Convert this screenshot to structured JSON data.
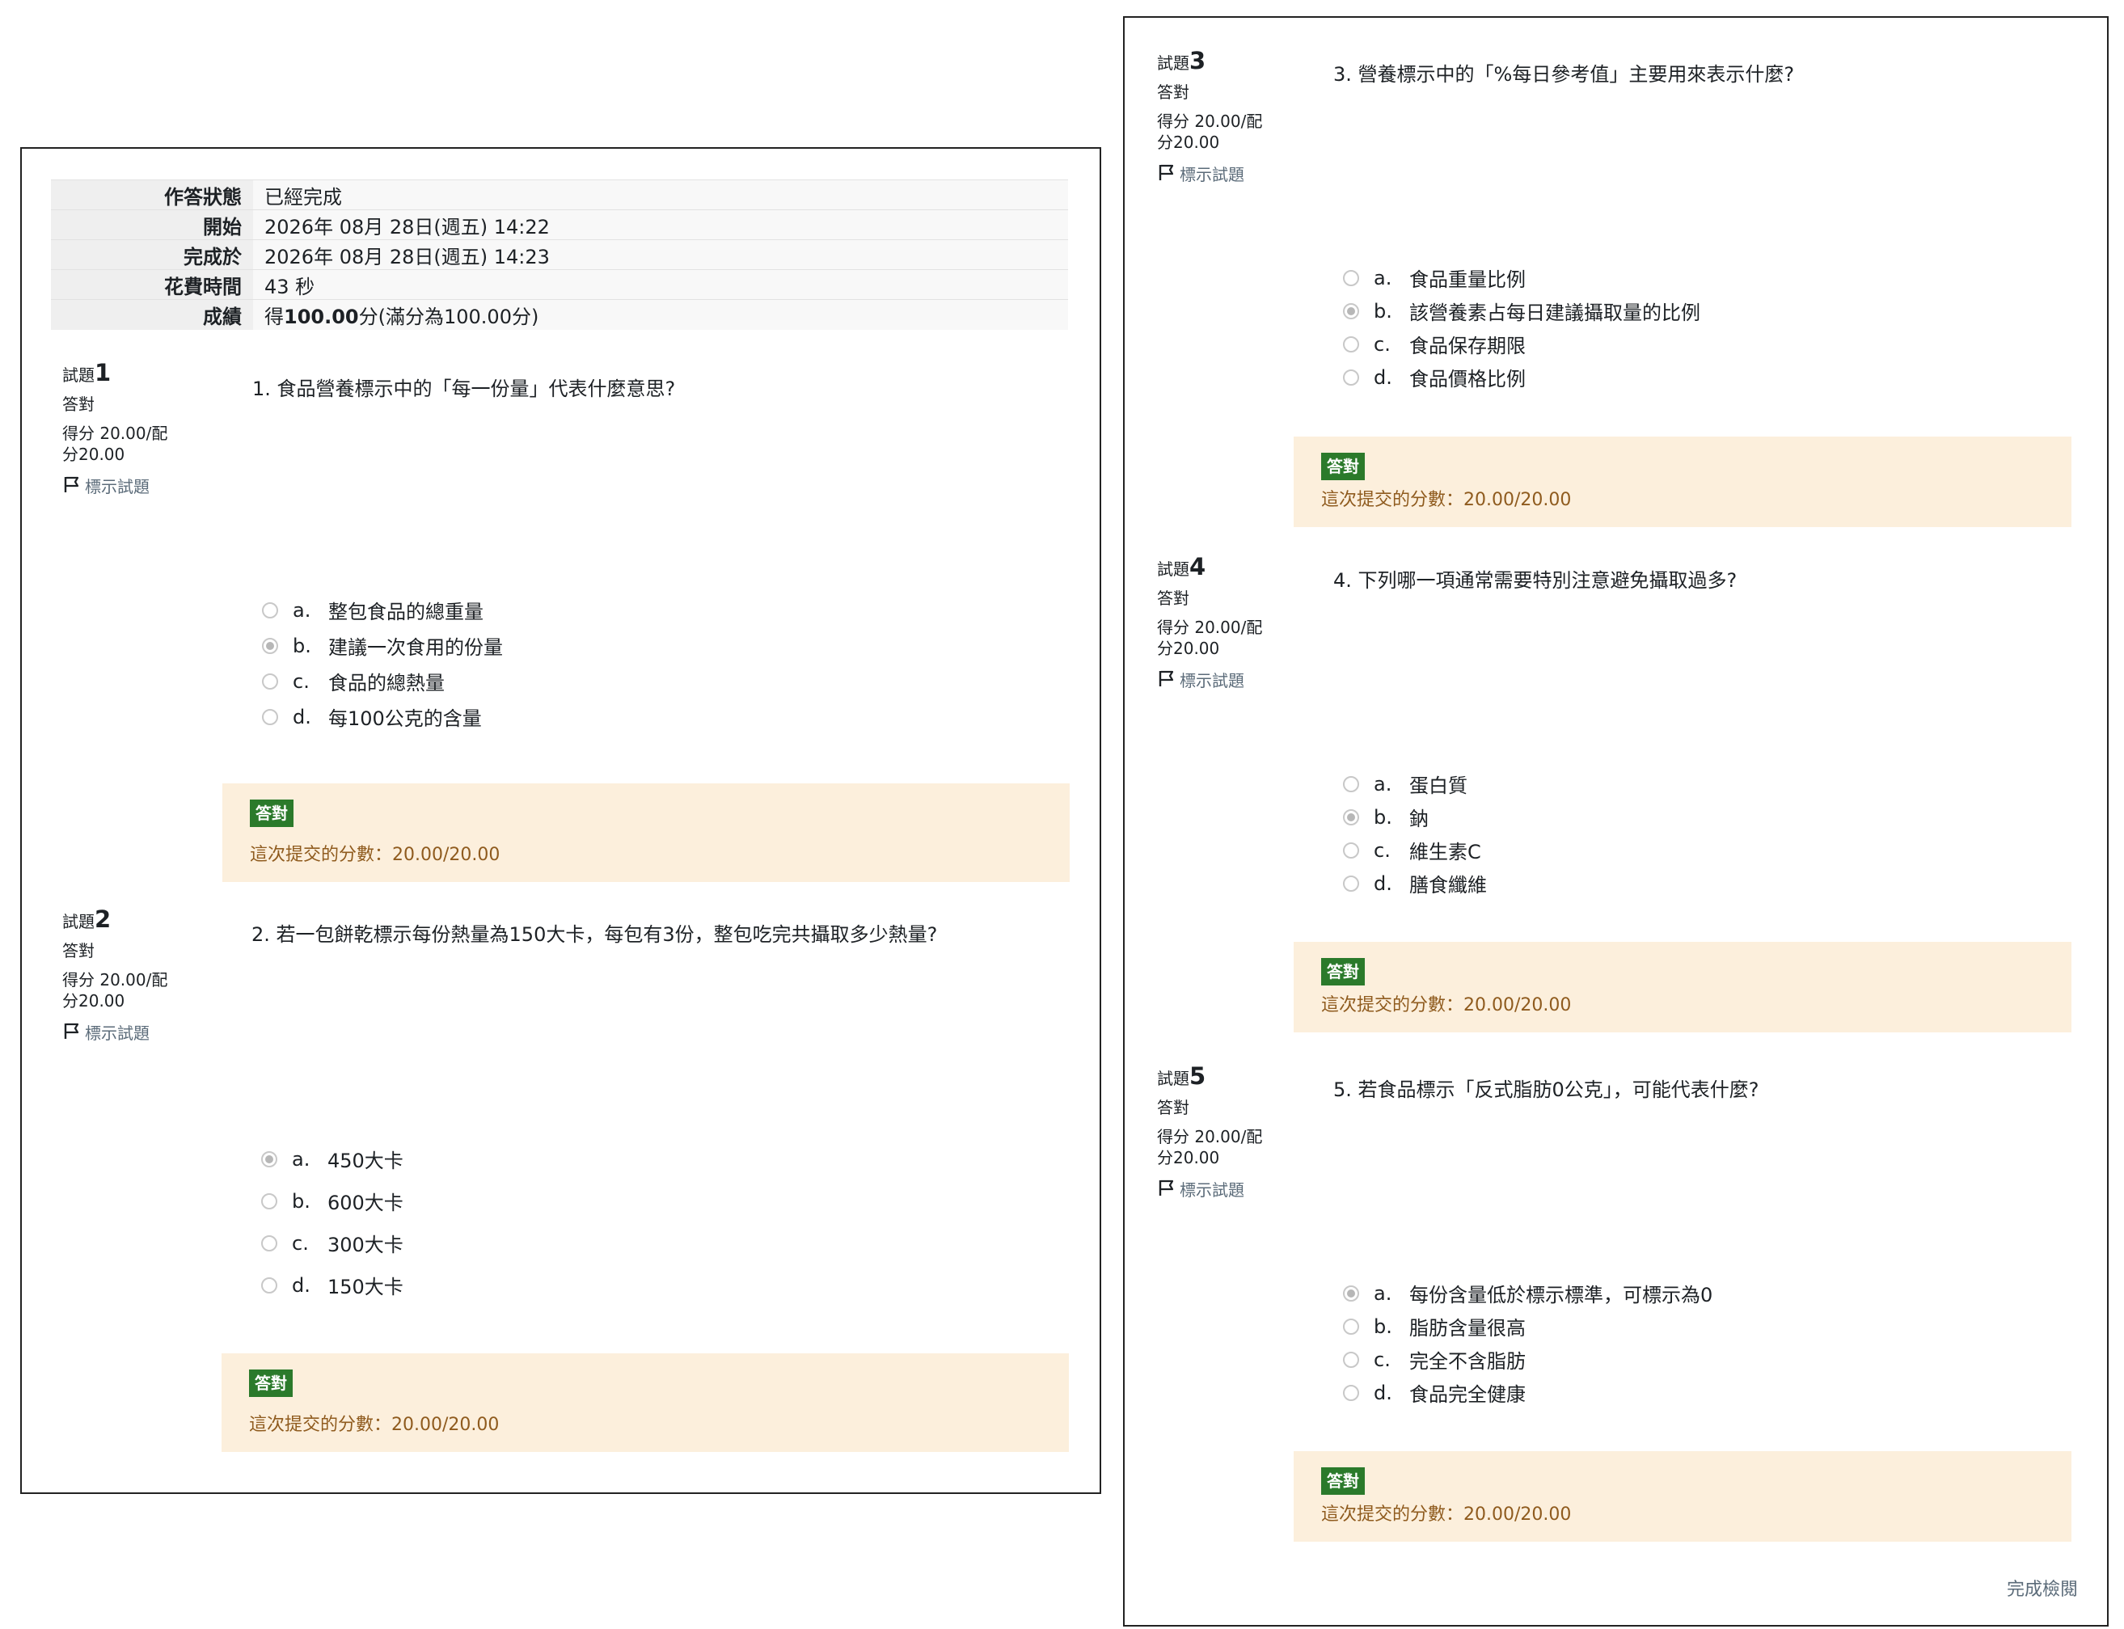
{
  "summary": {
    "rows": [
      {
        "label": "作答狀態",
        "value": "已經完成"
      },
      {
        "label": "開始",
        "value": "2026年 08月 28日(週五) 14:22"
      },
      {
        "label": "完成於",
        "value": "2026年 08月 28日(週五) 14:23"
      },
      {
        "label": "花費時間",
        "value": "43 秒"
      }
    ],
    "grade_label": "成績",
    "grade_prefix": "得",
    "grade_value": "100.00",
    "grade_suffix": "分(滿分為100.00分)"
  },
  "common": {
    "question_word": "試題",
    "state": "答對",
    "grade_line1": "得分 20.00/配",
    "grade_line2": "分20.00",
    "flag_label": "標示試題",
    "badge": "答對",
    "feedback": "這次提交的分數：20.00/20.00"
  },
  "questions": [
    {
      "number": "1",
      "text": "1. 食品營養標示中的「每一份量」代表什麼意思?",
      "selected": 1,
      "options": [
        {
          "letter": "a.",
          "text": "整包食品的總重量"
        },
        {
          "letter": "b.",
          "text": "建議一次食用的份量"
        },
        {
          "letter": "c.",
          "text": "食品的總熱量"
        },
        {
          "letter": "d.",
          "text": "每100公克的含量"
        }
      ]
    },
    {
      "number": "2",
      "text": "2. 若一包餅乾標示每份熱量為150大卡，每包有3份，整包吃完共攝取多少熱量?",
      "selected": 0,
      "options": [
        {
          "letter": "a.",
          "text": "450大卡"
        },
        {
          "letter": "b.",
          "text": "600大卡"
        },
        {
          "letter": "c.",
          "text": "300大卡"
        },
        {
          "letter": "d.",
          "text": "150大卡"
        }
      ]
    },
    {
      "number": "3",
      "text": "3. 營養標示中的「%每日參考值」主要用來表示什麼?",
      "selected": 1,
      "options": [
        {
          "letter": "a.",
          "text": "食品重量比例"
        },
        {
          "letter": "b.",
          "text": "該營養素占每日建議攝取量的比例"
        },
        {
          "letter": "c.",
          "text": "食品保存期限"
        },
        {
          "letter": "d.",
          "text": "食品價格比例"
        }
      ]
    },
    {
      "number": "4",
      "text": "4. 下列哪一項通常需要特別注意避免攝取過多?",
      "selected": 1,
      "options": [
        {
          "letter": "a.",
          "text": "蛋白質"
        },
        {
          "letter": "b.",
          "text": "鈉"
        },
        {
          "letter": "c.",
          "text": "維生素C"
        },
        {
          "letter": "d.",
          "text": "膳食纖維"
        }
      ]
    },
    {
      "number": "5",
      "text": "5. 若食品標示「反式脂肪0公克」，可能代表什麼?",
      "selected": 0,
      "options": [
        {
          "letter": "a.",
          "text": "每份含量低於標示標準，可標示為0"
        },
        {
          "letter": "b.",
          "text": "脂肪含量很高"
        },
        {
          "letter": "c.",
          "text": "完全不含脂肪"
        },
        {
          "letter": "d.",
          "text": "食品完全健康"
        }
      ]
    }
  ],
  "finish_review": "完成檢閱"
}
